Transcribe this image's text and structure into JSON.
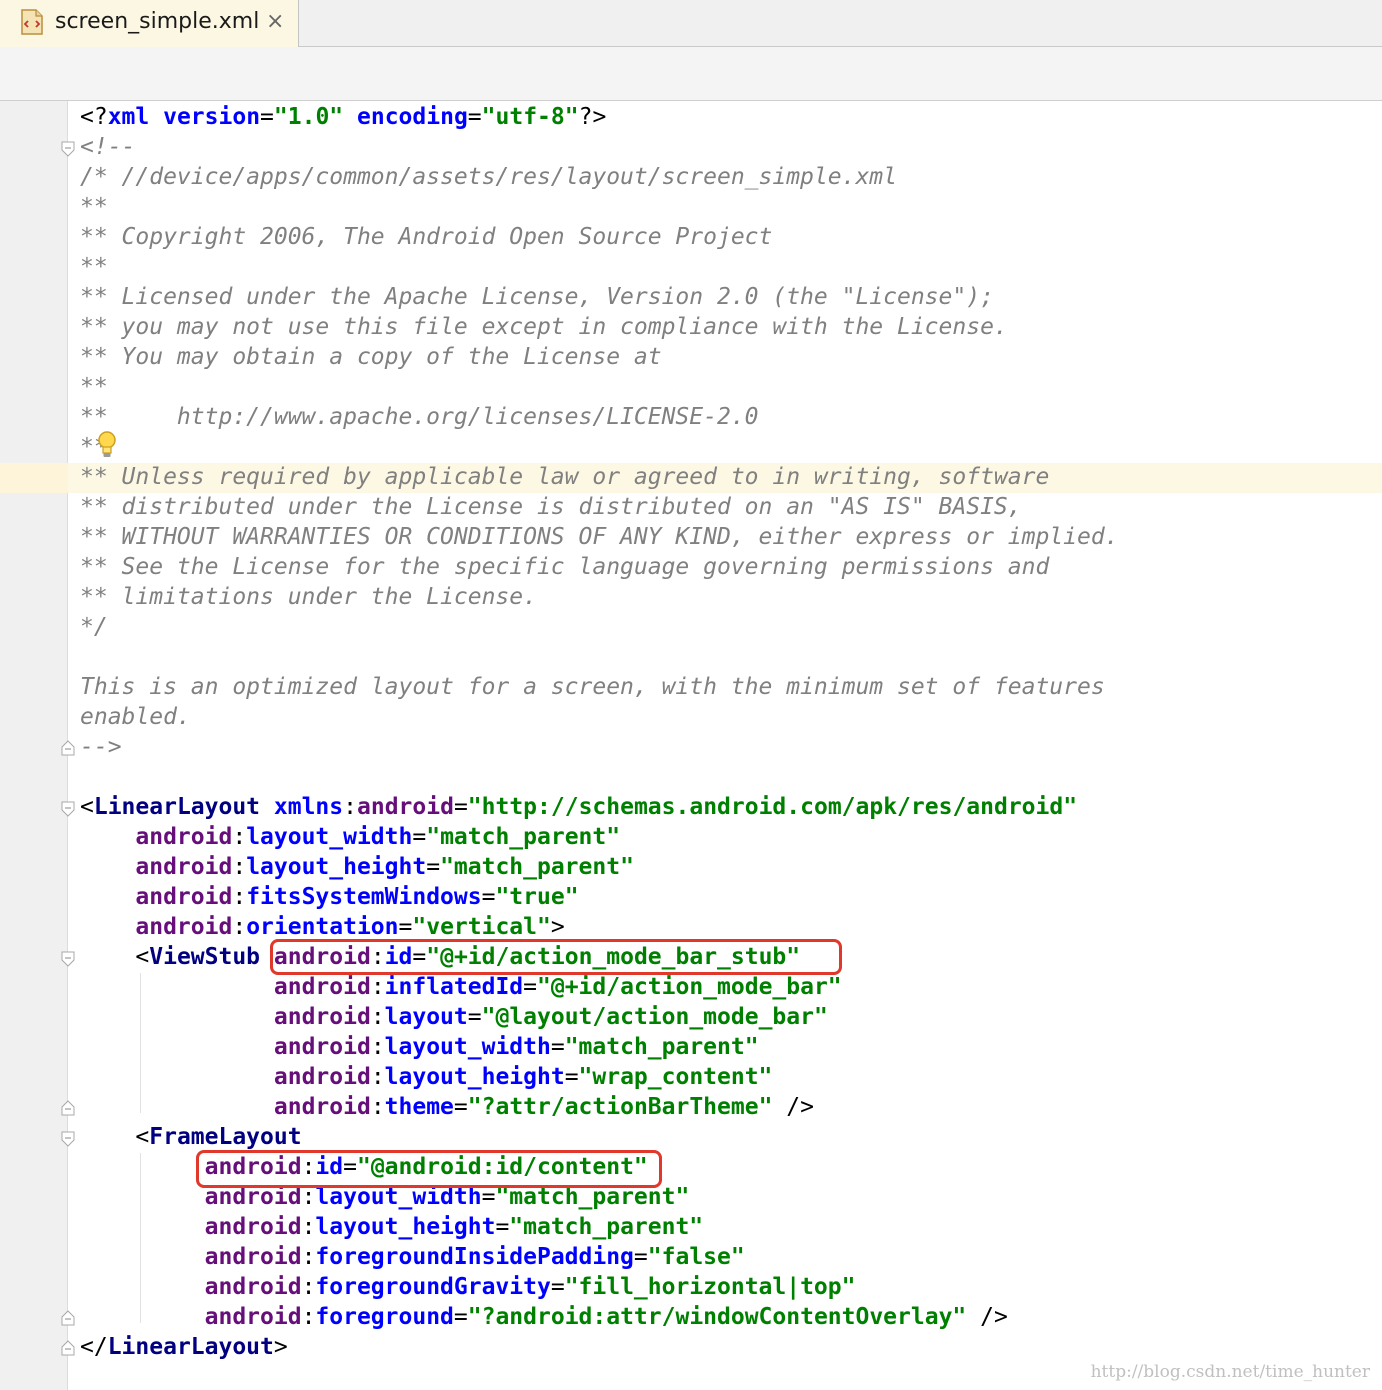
{
  "tab": {
    "title": "screen_simple.xml",
    "close": "×",
    "icon": "xml-file-icon"
  },
  "watermark": "http://blog.csdn.net/time_hunter",
  "colors": {
    "comment": "#808080",
    "tag": "#000080",
    "namespace": "#660e7a",
    "attribute": "#0000ff",
    "value": "#008000",
    "highlight": "#e0382b"
  },
  "lines": [
    [
      [
        "pl",
        "<?"
      ],
      [
        "at",
        "xml"
      ],
      [
        "pl",
        " "
      ],
      [
        "at",
        "version"
      ],
      [
        "pl",
        "="
      ],
      [
        "vl",
        "\"1.0\""
      ],
      [
        "pl",
        " "
      ],
      [
        "at",
        "encoding"
      ],
      [
        "pl",
        "="
      ],
      [
        "vl",
        "\"utf-8\""
      ],
      [
        "pl",
        "?>"
      ]
    ],
    [
      [
        "cm",
        "<!--"
      ]
    ],
    [
      [
        "cm",
        "/* //device/apps/common/assets/res/layout/screen_simple.xml"
      ]
    ],
    [
      [
        "cm",
        "**"
      ]
    ],
    [
      [
        "cm",
        "** Copyright 2006, The Android Open Source Project"
      ]
    ],
    [
      [
        "cm",
        "**"
      ]
    ],
    [
      [
        "cm",
        "** Licensed under the Apache License, Version 2.0 (the \"License\");"
      ]
    ],
    [
      [
        "cm",
        "** you may not use this file except in compliance with the License."
      ]
    ],
    [
      [
        "cm",
        "** You may obtain a copy of the License at"
      ]
    ],
    [
      [
        "cm",
        "**"
      ]
    ],
    [
      [
        "cm",
        "**     http://www.apache.org/licenses/LICENSE-2.0"
      ]
    ],
    [
      [
        "cm",
        "**"
      ]
    ],
    [
      [
        "cm",
        "** Unless required by applicable law or agreed to in writing, software"
      ]
    ],
    [
      [
        "cm",
        "** distributed under the License is distributed on an \"AS IS\" BASIS,"
      ]
    ],
    [
      [
        "cm",
        "** WITHOUT WARRANTIES OR CONDITIONS OF ANY KIND, either express or implied."
      ]
    ],
    [
      [
        "cm",
        "** See the License for the specific language governing permissions and"
      ]
    ],
    [
      [
        "cm",
        "** limitations under the License."
      ]
    ],
    [
      [
        "cm",
        "*/"
      ]
    ],
    [
      [
        "cm",
        ""
      ]
    ],
    [
      [
        "cm",
        "This is an optimized layout for a screen, with the minimum set of features"
      ]
    ],
    [
      [
        "cm",
        "enabled."
      ]
    ],
    [
      [
        "cm",
        "-->"
      ]
    ],
    [
      [
        "pl",
        ""
      ]
    ],
    [
      [
        "pl",
        "<"
      ],
      [
        "tg",
        "LinearLayout"
      ],
      [
        "pl",
        " "
      ],
      [
        "at",
        "xmlns"
      ],
      [
        "pl",
        ":"
      ],
      [
        "ns",
        "android"
      ],
      [
        "pl",
        "="
      ],
      [
        "vl",
        "\"http://schemas.android.com/apk/res/android\""
      ]
    ],
    [
      [
        "pl",
        "    "
      ],
      [
        "ns",
        "android"
      ],
      [
        "pl",
        ":"
      ],
      [
        "at",
        "layout_width"
      ],
      [
        "pl",
        "="
      ],
      [
        "vl",
        "\"match_parent\""
      ]
    ],
    [
      [
        "pl",
        "    "
      ],
      [
        "ns",
        "android"
      ],
      [
        "pl",
        ":"
      ],
      [
        "at",
        "layout_height"
      ],
      [
        "pl",
        "="
      ],
      [
        "vl",
        "\"match_parent\""
      ]
    ],
    [
      [
        "pl",
        "    "
      ],
      [
        "ns",
        "android"
      ],
      [
        "pl",
        ":"
      ],
      [
        "at",
        "fitsSystemWindows"
      ],
      [
        "pl",
        "="
      ],
      [
        "vl",
        "\"true\""
      ]
    ],
    [
      [
        "pl",
        "    "
      ],
      [
        "ns",
        "android"
      ],
      [
        "pl",
        ":"
      ],
      [
        "at",
        "orientation"
      ],
      [
        "pl",
        "="
      ],
      [
        "vl",
        "\"vertical\""
      ],
      [
        "pl",
        ">"
      ]
    ],
    [
      [
        "pl",
        "    <"
      ],
      [
        "tg",
        "ViewStub"
      ],
      [
        "pl",
        " "
      ],
      [
        "ns",
        "android"
      ],
      [
        "pl",
        ":"
      ],
      [
        "at",
        "id"
      ],
      [
        "pl",
        "="
      ],
      [
        "vl",
        "\"@+id/action_mode_bar_stub\""
      ]
    ],
    [
      [
        "pl",
        "              "
      ],
      [
        "ns",
        "android"
      ],
      [
        "pl",
        ":"
      ],
      [
        "at",
        "inflatedId"
      ],
      [
        "pl",
        "="
      ],
      [
        "vl",
        "\"@+id/action_mode_bar\""
      ]
    ],
    [
      [
        "pl",
        "              "
      ],
      [
        "ns",
        "android"
      ],
      [
        "pl",
        ":"
      ],
      [
        "at",
        "layout"
      ],
      [
        "pl",
        "="
      ],
      [
        "vl",
        "\"@layout/action_mode_bar\""
      ]
    ],
    [
      [
        "pl",
        "              "
      ],
      [
        "ns",
        "android"
      ],
      [
        "pl",
        ":"
      ],
      [
        "at",
        "layout_width"
      ],
      [
        "pl",
        "="
      ],
      [
        "vl",
        "\"match_parent\""
      ]
    ],
    [
      [
        "pl",
        "              "
      ],
      [
        "ns",
        "android"
      ],
      [
        "pl",
        ":"
      ],
      [
        "at",
        "layout_height"
      ],
      [
        "pl",
        "="
      ],
      [
        "vl",
        "\"wrap_content\""
      ]
    ],
    [
      [
        "pl",
        "              "
      ],
      [
        "ns",
        "android"
      ],
      [
        "pl",
        ":"
      ],
      [
        "at",
        "theme"
      ],
      [
        "pl",
        "="
      ],
      [
        "vl",
        "\"?attr/actionBarTheme\""
      ],
      [
        "pl",
        " />"
      ]
    ],
    [
      [
        "pl",
        "    <"
      ],
      [
        "tg",
        "FrameLayout"
      ]
    ],
    [
      [
        "pl",
        "         "
      ],
      [
        "ns",
        "android"
      ],
      [
        "pl",
        ":"
      ],
      [
        "at",
        "id"
      ],
      [
        "pl",
        "="
      ],
      [
        "vl",
        "\"@android:id/content\""
      ]
    ],
    [
      [
        "pl",
        "         "
      ],
      [
        "ns",
        "android"
      ],
      [
        "pl",
        ":"
      ],
      [
        "at",
        "layout_width"
      ],
      [
        "pl",
        "="
      ],
      [
        "vl",
        "\"match_parent\""
      ]
    ],
    [
      [
        "pl",
        "         "
      ],
      [
        "ns",
        "android"
      ],
      [
        "pl",
        ":"
      ],
      [
        "at",
        "layout_height"
      ],
      [
        "pl",
        "="
      ],
      [
        "vl",
        "\"match_parent\""
      ]
    ],
    [
      [
        "pl",
        "         "
      ],
      [
        "ns",
        "android"
      ],
      [
        "pl",
        ":"
      ],
      [
        "at",
        "foregroundInsidePadding"
      ],
      [
        "pl",
        "="
      ],
      [
        "vl",
        "\"false\""
      ]
    ],
    [
      [
        "pl",
        "         "
      ],
      [
        "ns",
        "android"
      ],
      [
        "pl",
        ":"
      ],
      [
        "at",
        "foregroundGravity"
      ],
      [
        "pl",
        "="
      ],
      [
        "vl",
        "\"fill_horizontal|top\""
      ]
    ],
    [
      [
        "pl",
        "         "
      ],
      [
        "ns",
        "android"
      ],
      [
        "pl",
        ":"
      ],
      [
        "at",
        "foreground"
      ],
      [
        "pl",
        "="
      ],
      [
        "vl",
        "\"?android:attr/windowContentOverlay\""
      ],
      [
        "pl",
        " />"
      ]
    ],
    [
      [
        "pl",
        "</"
      ],
      [
        "tg",
        "LinearLayout"
      ],
      [
        "pl",
        ">"
      ]
    ]
  ]
}
